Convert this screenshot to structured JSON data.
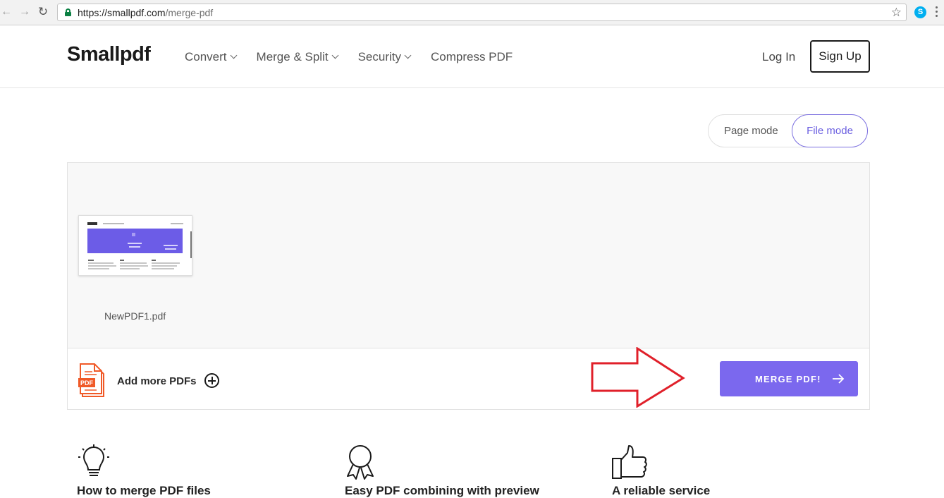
{
  "browser": {
    "url_host": "https://smallpdf.com",
    "url_path": "/merge-pdf",
    "ext_icon_label": "S",
    "icons": [
      "back-arrow-icon",
      "forward-arrow-icon",
      "reload-icon",
      "lock-icon",
      "star-icon",
      "skype-icon",
      "menu-dots-icon"
    ]
  },
  "header": {
    "logo": "Smallpdf",
    "nav": [
      {
        "label": "Convert",
        "has_dropdown": true
      },
      {
        "label": "Merge & Split",
        "has_dropdown": true
      },
      {
        "label": "Security",
        "has_dropdown": true
      },
      {
        "label": "Compress PDF",
        "has_dropdown": false
      }
    ],
    "login_label": "Log In",
    "signup_label": "Sign Up"
  },
  "mode_toggle": {
    "page_mode_label": "Page mode",
    "file_mode_label": "File mode",
    "active": "File mode"
  },
  "files": [
    {
      "name": "NewPDF1.pdf"
    }
  ],
  "actions": {
    "add_more_label": "Add more PDFs",
    "merge_label": "MERGE PDF!"
  },
  "features": [
    {
      "title": "How to merge PDF files",
      "icon": "lightbulb-icon"
    },
    {
      "title": "Easy PDF combining with preview",
      "icon": "award-ribbon-icon"
    },
    {
      "title": "A reliable service",
      "icon": "thumbs-up-icon"
    }
  ],
  "colors": {
    "accent": "#7b68ee",
    "annotation_arrow": "#e0202a",
    "pdf_icon": "#f05a28",
    "secure_green": "#0b8043"
  }
}
